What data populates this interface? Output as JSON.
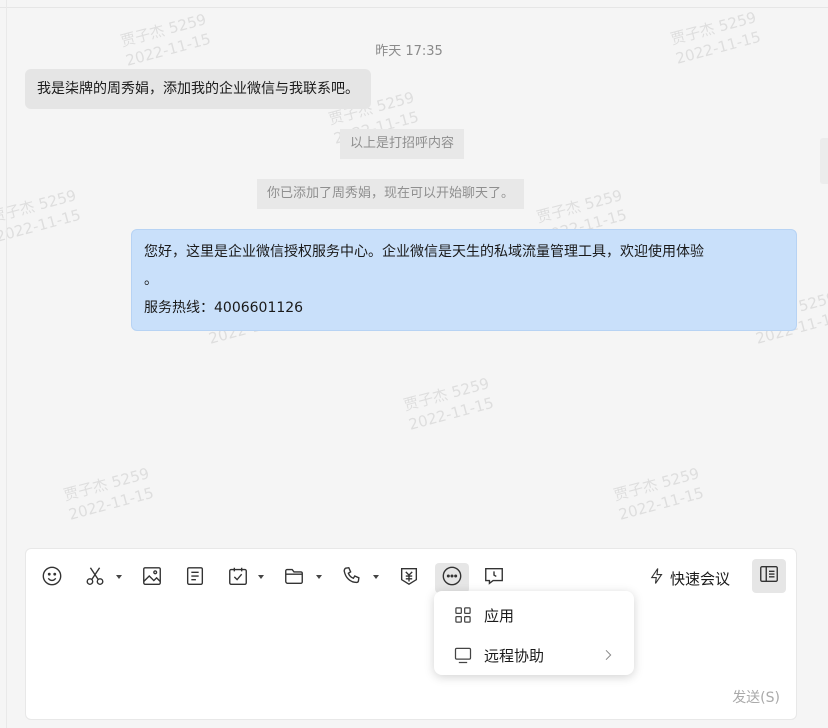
{
  "chat": {
    "timestamp": "昨天 17:35",
    "incoming_message": "我是柒牌的周秀娟，添加我的企业微信与我联系吧。",
    "system_notice_1": "以上是打招呼内容",
    "system_notice_2": "你已添加了周秀娟，现在可以开始聊天了。",
    "outgoing_message": {
      "line1": "您好，这里是企业微信授权服务中心。企业微信是天生的私域流量管理工具，欢迎使用体验",
      "line2": "。",
      "line3": "服务热线：4006601126"
    },
    "watermark": {
      "name": "贾子杰 5259",
      "date": "2022-11-15"
    }
  },
  "toolbar": {
    "icons": [
      "emoji-icon",
      "scissors-icon",
      "image-icon",
      "document-icon",
      "calendar-check-icon",
      "folder-icon",
      "phone-icon",
      "money-icon",
      "more-icon",
      "remote-screen-icon"
    ],
    "quick_meeting_label": "快速会议",
    "send_label": "发送(S)"
  },
  "more_menu": {
    "items": [
      {
        "label": "应用",
        "icon": "apps-grid-icon"
      },
      {
        "label": "远程协助",
        "icon": "monitor-icon",
        "has_submenu": true
      }
    ]
  },
  "colors": {
    "outgoing_bubble": "#c9e0fa",
    "incoming_bubble": "#e5e5e5",
    "background": "#f5f5f5"
  }
}
